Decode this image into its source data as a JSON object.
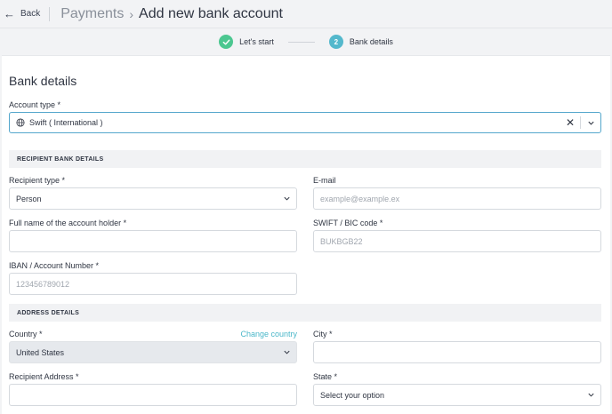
{
  "header": {
    "back_label": "Back",
    "breadcrumb_parent": "Payments",
    "page_title": "Add new bank account"
  },
  "stepper": {
    "steps": [
      {
        "label": "Let's start",
        "state": "done"
      },
      {
        "label": "Bank details",
        "number": "2",
        "state": "current"
      }
    ]
  },
  "form": {
    "title": "Bank details",
    "account_type": {
      "label": "Account type *",
      "value": "Swift ( International )"
    },
    "sections": {
      "recipient_bank": "RECIPIENT BANK DETAILS",
      "address": "ADDRESS DETAILS"
    },
    "recipient_type": {
      "label": "Recipient type *",
      "value": "Person"
    },
    "email": {
      "label": "E-mail",
      "placeholder": "example@example.ex"
    },
    "full_name": {
      "label": "Full name of the account holder *",
      "value": ""
    },
    "swift": {
      "label": "SWIFT / BIC code *",
      "placeholder": "BUKBGB22"
    },
    "iban": {
      "label": "IBAN / Account Number *",
      "placeholder": "123456789012"
    },
    "country": {
      "label": "Country *",
      "value": "United States",
      "change_link": "Change country"
    },
    "city": {
      "label": "City *",
      "value": ""
    },
    "recipient_address": {
      "label": "Recipient Address *",
      "value": ""
    },
    "state": {
      "label": "State *",
      "placeholder": "Select your option"
    }
  },
  "colors": {
    "accent": "#54b8cc",
    "success": "#4cc790",
    "link": "#4ab7c9",
    "focus_border": "#54a7cc"
  }
}
